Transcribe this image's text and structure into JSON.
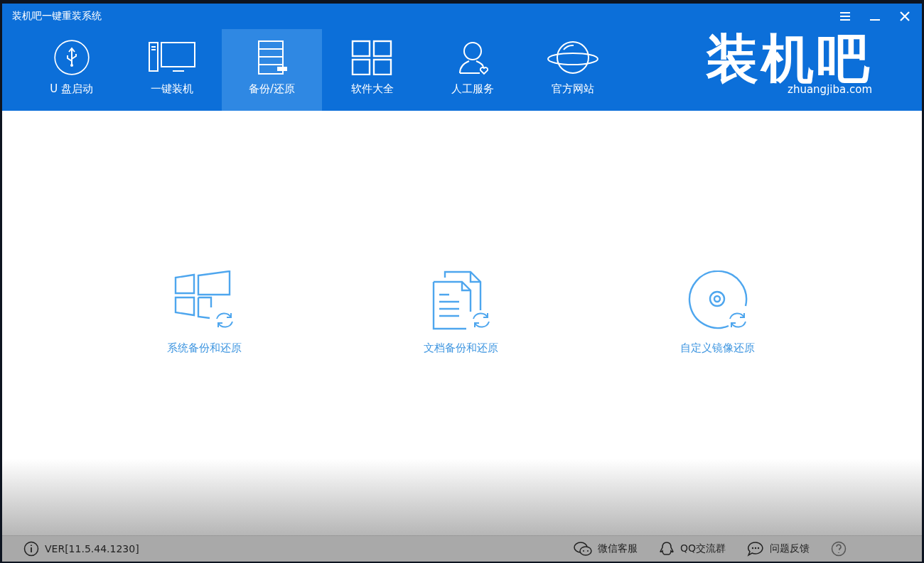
{
  "window": {
    "title": "装机吧一键重装系统"
  },
  "window_controls": [
    {
      "kind": "menu"
    },
    {
      "kind": "minimize"
    },
    {
      "kind": "close"
    }
  ],
  "tabs": [
    {
      "kind": "usb",
      "label": "U 盘启动",
      "selected": false
    },
    {
      "kind": "pc",
      "label": "一键装机",
      "selected": false
    },
    {
      "kind": "backup",
      "label": "备份/还原",
      "selected": true
    },
    {
      "kind": "apps",
      "label": "软件大全",
      "selected": false
    },
    {
      "kind": "person",
      "label": "人工服务",
      "selected": false
    },
    {
      "kind": "globe",
      "label": "官方网站",
      "selected": false
    }
  ],
  "logo": {
    "title": "装机吧",
    "url": "zhuangjiba.com"
  },
  "options": [
    {
      "kind": "windows",
      "label": "系统备份和还原"
    },
    {
      "kind": "docs",
      "label": "文档备份和还原"
    },
    {
      "kind": "disc",
      "label": "自定义镜像还原"
    }
  ],
  "status_bar": {
    "version": "VER[11.5.44.1230]",
    "links": [
      {
        "kind": "wechat",
        "label": "微信客服"
      },
      {
        "kind": "qq",
        "label": "QQ交流群"
      },
      {
        "kind": "chat",
        "label": "问题反馈"
      },
      {
        "kind": "help"
      }
    ]
  }
}
